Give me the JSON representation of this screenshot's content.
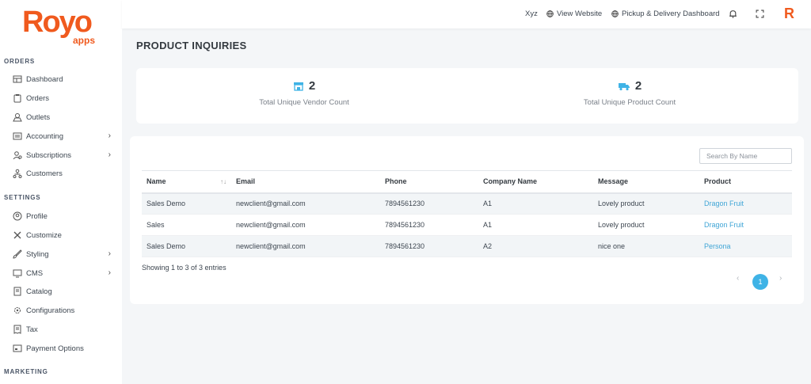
{
  "brand": {
    "logo_main": "Royo",
    "logo_sub": "apps",
    "r_icon": "R",
    "accent": "#f05a1e",
    "link_color": "#3fa5d6"
  },
  "sidebar": {
    "sections": [
      {
        "title": "ORDERS"
      },
      {
        "title": "SETTINGS"
      },
      {
        "title": "MARKETING"
      }
    ],
    "items": [
      {
        "label": "Dashboard",
        "icon": "dashboard-icon"
      },
      {
        "label": "Orders",
        "icon": "clipboard-icon"
      },
      {
        "label": "Outlets",
        "icon": "store-icon"
      },
      {
        "label": "Accounting",
        "icon": "ledger-icon",
        "expandable": true
      },
      {
        "label": "Subscriptions",
        "icon": "users-icon",
        "expandable": true
      },
      {
        "label": "Customers",
        "icon": "network-icon"
      },
      {
        "label": "Profile",
        "icon": "user-circle-icon"
      },
      {
        "label": "Customize",
        "icon": "tools-icon"
      },
      {
        "label": "Styling",
        "icon": "brush-icon",
        "expandable": true
      },
      {
        "label": "CMS",
        "icon": "monitor-icon",
        "expandable": true
      },
      {
        "label": "Catalog",
        "icon": "book-icon"
      },
      {
        "label": "Configurations",
        "icon": "gears-icon"
      },
      {
        "label": "Tax",
        "icon": "receipt-icon"
      },
      {
        "label": "Payment Options",
        "icon": "payment-icon"
      }
    ]
  },
  "topbar": {
    "user": "Xyz",
    "view_website": "View Website",
    "pickup_dashboard": "Pickup & Delivery Dashboard"
  },
  "page": {
    "title": "PRODUCT INQUIRIES"
  },
  "stats": [
    {
      "value": "2",
      "label": "Total Unique Vendor Count",
      "icon": "store-front-icon"
    },
    {
      "value": "2",
      "label": "Total Unique Product Count",
      "icon": "delivery-truck-icon"
    }
  ],
  "table": {
    "search_placeholder": "Search By Name",
    "columns": [
      "Name",
      "Email",
      "Phone",
      "Company Name",
      "Message",
      "Product"
    ],
    "rows": [
      [
        "Sales Demo",
        "newclient@gmail.com",
        "7894561230",
        "A1",
        "Lovely product",
        "Dragon Fruit"
      ],
      [
        "Sales",
        "newclient@gmail.com",
        "7894561230",
        "A1",
        "Lovely product",
        "Dragon Fruit"
      ],
      [
        "Sales Demo",
        "newclient@gmail.com",
        "7894561230",
        "A2",
        "nice one",
        "Persona"
      ]
    ],
    "info": "Showing 1 to 3 of 3 entries",
    "pagination": {
      "prev": "‹",
      "current": "1",
      "next": "›"
    }
  }
}
